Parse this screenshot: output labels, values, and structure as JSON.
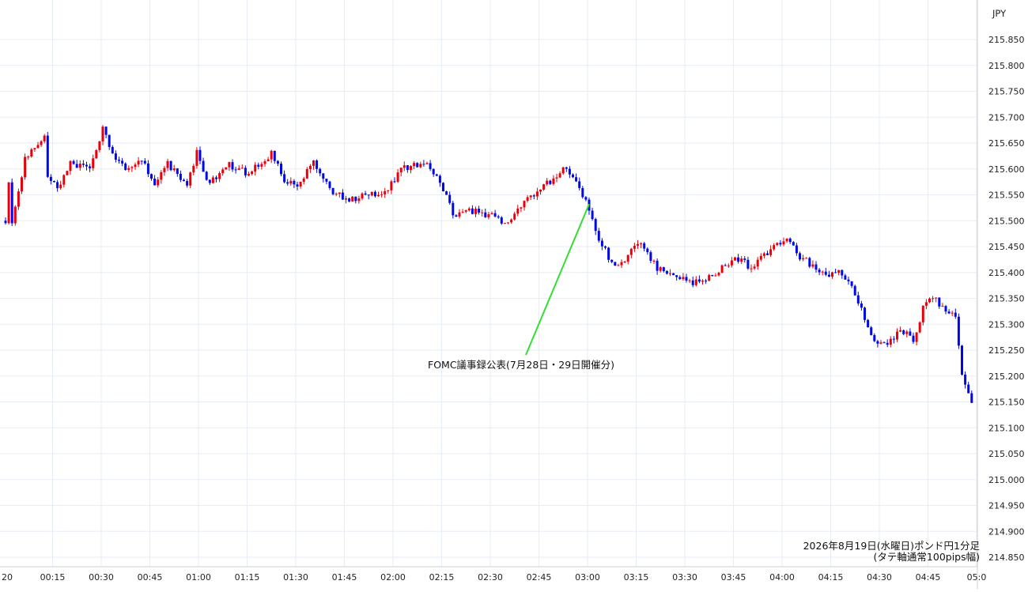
{
  "chart_data": {
    "type": "candlestick",
    "currency_label": "JPY",
    "caption_line1": "2026年8月19日(水曜日)ポンド円1分足",
    "caption_line2": "(タテ軸通常100pips幅)",
    "annotation": {
      "text": "FOMC議事録公表(7月28日・29日開催分)",
      "time": "03:00",
      "price": 215.532
    },
    "ylim": [
      214.85,
      215.885
    ],
    "y_ticks": [
      215.85,
      215.8,
      215.75,
      215.7,
      215.65,
      215.6,
      215.55,
      215.5,
      215.45,
      215.4,
      215.35,
      215.3,
      215.25,
      215.2,
      215.15,
      215.1,
      215.05,
      215.0,
      214.95,
      214.9,
      214.85
    ],
    "x_start": "00:00",
    "x_labels": [
      "20",
      "00:15",
      "00:30",
      "00:45",
      "01:00",
      "01:15",
      "01:30",
      "01:45",
      "02:00",
      "02:15",
      "02:30",
      "02:45",
      "03:00",
      "03:15",
      "03:30",
      "03:45",
      "04:00",
      "04:15",
      "04:30",
      "04:45",
      "05:0"
    ],
    "up_color": "#e8000b",
    "down_color": "#0008e6",
    "annotation_line_color": "#33dd33",
    "control_points": [
      {
        "t": 0,
        "p": 215.5
      },
      {
        "t": 1,
        "p": 215.57
      },
      {
        "t": 2,
        "p": 215.5
      },
      {
        "t": 6,
        "p": 215.62
      },
      {
        "t": 12,
        "p": 215.66
      },
      {
        "t": 13,
        "p": 215.59
      },
      {
        "t": 16,
        "p": 215.56
      },
      {
        "t": 20,
        "p": 215.61
      },
      {
        "t": 26,
        "p": 215.6
      },
      {
        "t": 30,
        "p": 215.68
      },
      {
        "t": 33,
        "p": 215.63
      },
      {
        "t": 37,
        "p": 215.6
      },
      {
        "t": 42,
        "p": 215.62
      },
      {
        "t": 46,
        "p": 215.57
      },
      {
        "t": 50,
        "p": 215.61
      },
      {
        "t": 56,
        "p": 215.57
      },
      {
        "t": 59,
        "p": 215.63
      },
      {
        "t": 63,
        "p": 215.57
      },
      {
        "t": 68,
        "p": 215.61
      },
      {
        "t": 75,
        "p": 215.59
      },
      {
        "t": 82,
        "p": 215.63
      },
      {
        "t": 86,
        "p": 215.58
      },
      {
        "t": 90,
        "p": 215.57
      },
      {
        "t": 95,
        "p": 215.61
      },
      {
        "t": 100,
        "p": 215.56
      },
      {
        "t": 106,
        "p": 215.54
      },
      {
        "t": 111,
        "p": 215.55
      },
      {
        "t": 118,
        "p": 215.56
      },
      {
        "t": 122,
        "p": 215.6
      },
      {
        "t": 130,
        "p": 215.61
      },
      {
        "t": 134,
        "p": 215.58
      },
      {
        "t": 138,
        "p": 215.51
      },
      {
        "t": 142,
        "p": 215.52
      },
      {
        "t": 151,
        "p": 215.51
      },
      {
        "t": 154,
        "p": 215.49
      },
      {
        "t": 160,
        "p": 215.54
      },
      {
        "t": 165,
        "p": 215.56
      },
      {
        "t": 172,
        "p": 215.6
      },
      {
        "t": 175,
        "p": 215.58
      },
      {
        "t": 179,
        "p": 215.54
      },
      {
        "t": 182,
        "p": 215.48
      },
      {
        "t": 186,
        "p": 215.43
      },
      {
        "t": 189,
        "p": 215.41
      },
      {
        "t": 195,
        "p": 215.46
      },
      {
        "t": 201,
        "p": 215.41
      },
      {
        "t": 207,
        "p": 215.39
      },
      {
        "t": 213,
        "p": 215.38
      },
      {
        "t": 219,
        "p": 215.4
      },
      {
        "t": 225,
        "p": 215.43
      },
      {
        "t": 230,
        "p": 215.41
      },
      {
        "t": 235,
        "p": 215.44
      },
      {
        "t": 241,
        "p": 215.47
      },
      {
        "t": 245,
        "p": 215.43
      },
      {
        "t": 250,
        "p": 215.41
      },
      {
        "t": 254,
        "p": 215.39
      },
      {
        "t": 257,
        "p": 215.41
      },
      {
        "t": 260,
        "p": 215.38
      },
      {
        "t": 264,
        "p": 215.33
      },
      {
        "t": 268,
        "p": 215.27
      },
      {
        "t": 272,
        "p": 215.26
      },
      {
        "t": 276,
        "p": 215.29
      },
      {
        "t": 280,
        "p": 215.27
      },
      {
        "t": 283,
        "p": 215.33
      },
      {
        "t": 286,
        "p": 215.35
      },
      {
        "t": 290,
        "p": 215.33
      },
      {
        "t": 293,
        "p": 215.31
      },
      {
        "t": 295,
        "p": 215.2
      },
      {
        "t": 298,
        "p": 215.15
      }
    ]
  }
}
